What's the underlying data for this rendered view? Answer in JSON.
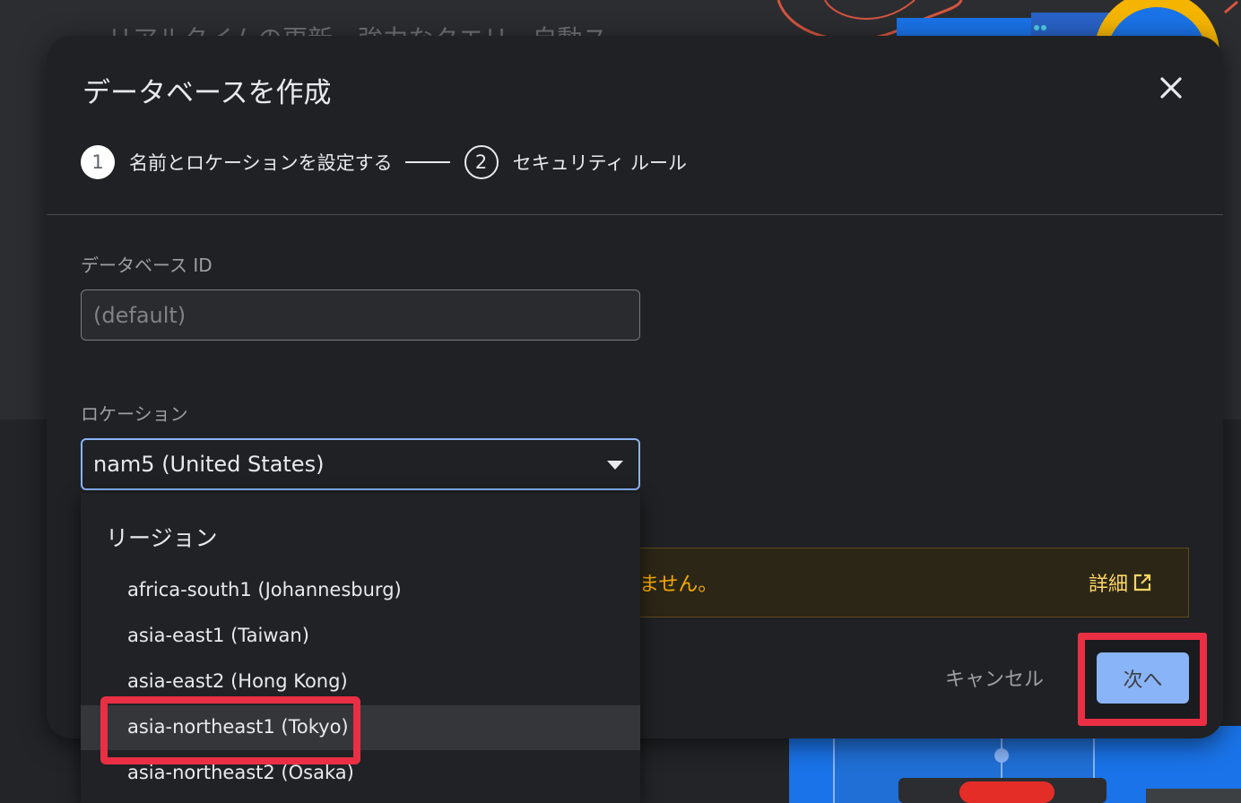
{
  "background": {
    "ghost_text": "リアルタイムの更新、強力なクエリ、自動ス"
  },
  "dialog": {
    "title": "データベースを作成",
    "close_icon": "close-icon",
    "stepper": {
      "step1": {
        "number": "1",
        "label": "名前とロケーションを設定する"
      },
      "step2": {
        "number": "2",
        "label": "セキュリティ ルール"
      }
    },
    "database_id": {
      "label": "データベース ID",
      "placeholder": "(default)"
    },
    "location": {
      "label": "ロケーション",
      "selected": "nam5 (United States)",
      "dropdown_icon": "arrow-drop-down-icon"
    },
    "warning": {
      "text": "ません。",
      "details_label": "詳細",
      "details_icon": "open-in-new-icon"
    },
    "actions": {
      "cancel_label": "キャンセル",
      "next_label": "次へ"
    }
  },
  "dropdown": {
    "group_label": "リージョン",
    "options": [
      "africa-south1 (Johannesburg)",
      "asia-east1 (Taiwan)",
      "asia-east2 (Hong Kong)",
      "asia-northeast1 (Tokyo)",
      "asia-northeast2 (Osaka)"
    ],
    "hovered_option": "asia-northeast1 (Tokyo)"
  },
  "colors": {
    "accent": "#8ab4f8",
    "annotation_red": "#ea2f45",
    "warning": "#f9ab00"
  }
}
